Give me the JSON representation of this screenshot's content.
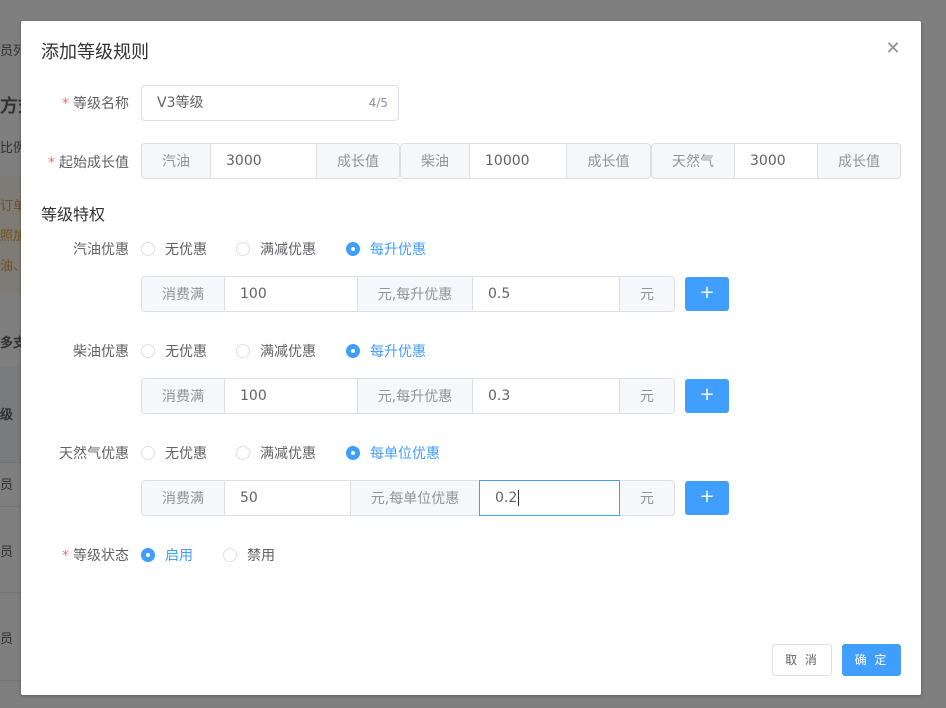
{
  "background": {
    "fragments": [
      "员列",
      "方式",
      "比例",
      "订单",
      "照加",
      "油、",
      "多支",
      "级",
      "员",
      "员",
      "员"
    ]
  },
  "dialog": {
    "title": "添加等级规则",
    "close_icon": "close-icon",
    "level_name": {
      "label": "等级名称",
      "value": "V3等级",
      "count": "4/5"
    },
    "start_growth": {
      "label": "起始成长值",
      "groups": [
        {
          "name": "汽油",
          "value": "3000",
          "unit": "成长值"
        },
        {
          "name": "柴油",
          "value": "10000",
          "unit": "成长值"
        },
        {
          "name": "天然气",
          "value": "3000",
          "unit": "成长值"
        }
      ]
    },
    "privilege_title": "等级特权",
    "gasoline": {
      "label": "汽油优惠",
      "options": [
        "无优惠",
        "满减优惠",
        "每升优惠"
      ],
      "selected": 2,
      "prefix": "消费满",
      "amount": "100",
      "mid": "元,每升优惠",
      "discount": "0.5",
      "unit": "元",
      "add": "+"
    },
    "diesel": {
      "label": "柴油优惠",
      "options": [
        "无优惠",
        "满减优惠",
        "每升优惠"
      ],
      "selected": 2,
      "prefix": "消费满",
      "amount": "100",
      "mid": "元,每升优惠",
      "discount": "0.3",
      "unit": "元",
      "add": "+"
    },
    "gas": {
      "label": "天然气优惠",
      "options": [
        "无优惠",
        "满减优惠",
        "每单位优惠"
      ],
      "selected": 2,
      "prefix": "消费满",
      "amount": "50",
      "mid": "元,每单位优惠",
      "discount": "0.2",
      "unit": "元",
      "add": "+"
    },
    "status": {
      "label": "等级状态",
      "options": [
        "启用",
        "禁用"
      ],
      "selected": 0
    },
    "footer": {
      "cancel": "取 消",
      "ok": "确 定"
    }
  }
}
